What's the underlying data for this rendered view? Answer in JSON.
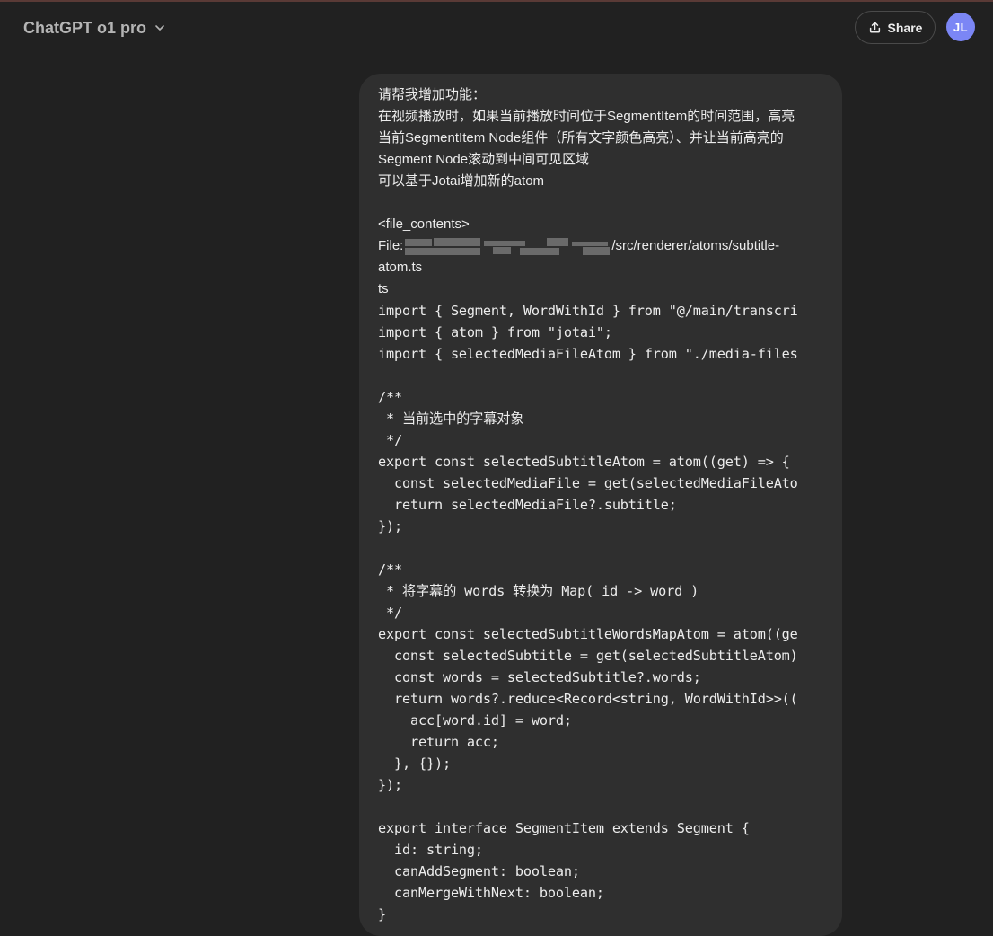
{
  "header": {
    "model_name": "ChatGPT o1 pro",
    "share_label": "Share",
    "avatar_initials": "JL"
  },
  "icons": {
    "model_dropdown": "chevron-down-icon",
    "share": "share-upload-icon"
  },
  "colors": {
    "background": "#212121",
    "bubble": "#2f2f2f",
    "avatar": "#7b86f5",
    "text": "#ececec"
  },
  "message": {
    "prose": [
      "请帮我增加功能：",
      "在视频播放时，如果当前播放时间位于SegmentItem的时间范围，高亮",
      "当前SegmentItem Node组件（所有文字颜色高亮）、并让当前高亮的",
      "Segment Node滚动到中间可见区域",
      "可以基于Jotai增加新的atom"
    ],
    "file_open_tag": "<file_contents>",
    "file_prefix": "File:",
    "file_path_suffix": "/src/renderer/atoms/subtitle-",
    "file_path_cont": "atom.ts",
    "lang": "ts",
    "code": [
      "import { Segment, WordWithId } from \"@/main/transcri",
      "import { atom } from \"jotai\";",
      "import { selectedMediaFileAtom } from \"./media-files",
      "",
      "/**",
      " * 当前选中的字幕对象",
      " */",
      "export const selectedSubtitleAtom = atom((get) => {",
      "  const selectedMediaFile = get(selectedMediaFileAto",
      "  return selectedMediaFile?.subtitle;",
      "});",
      "",
      "/**",
      " * 将字幕的 words 转换为 Map( id -> word )",
      " */",
      "export const selectedSubtitleWordsMapAtom = atom((ge",
      "  const selectedSubtitle = get(selectedSubtitleAtom)",
      "  const words = selectedSubtitle?.words;",
      "  return words?.reduce<Record<string, WordWithId>>((",
      "    acc[word.id] = word;",
      "    return acc;",
      "  }, {});",
      "});",
      "",
      "export interface SegmentItem extends Segment {",
      "  id: string;",
      "  canAddSegment: boolean;",
      "  canMergeWithNext: boolean;",
      "}"
    ]
  }
}
